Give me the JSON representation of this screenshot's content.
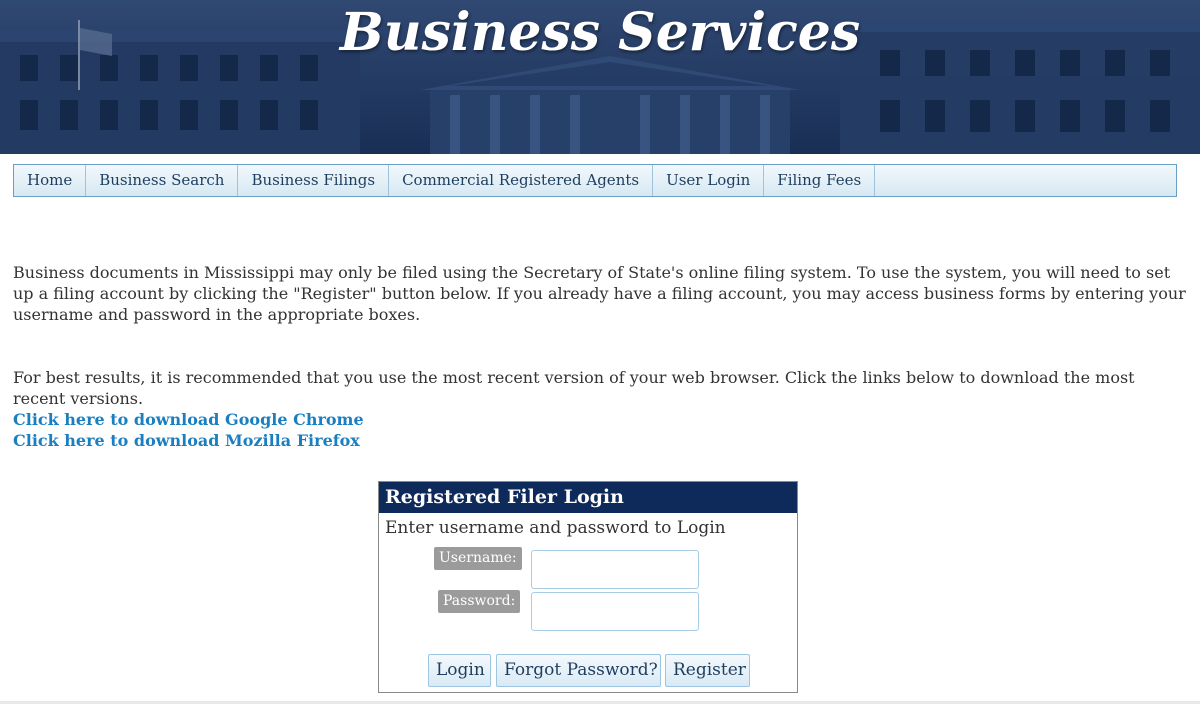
{
  "banner": {
    "title": "Business Services"
  },
  "nav": {
    "items": [
      {
        "label": "Home"
      },
      {
        "label": "Business Search"
      },
      {
        "label": "Business Filings"
      },
      {
        "label": "Commercial Registered Agents"
      },
      {
        "label": "User Login"
      },
      {
        "label": "Filing Fees"
      }
    ]
  },
  "content": {
    "intro": "Business documents in Mississippi may only be filed using the Secretary of State's online filing system. To use the system, you will need to set up a filing account by clicking the \"Register\" button below. If you already have a filing account, you may access business forms by entering your username and password in the appropriate boxes.",
    "browser_note": "For best results, it is recommended that you use the most recent version of your web browser. Click the links below to download the most recent versions.",
    "chrome_link": "Click here to download Google Chrome",
    "firefox_link": "Click here to download Mozilla Firefox"
  },
  "login": {
    "header": "Registered Filer Login",
    "instructions": "Enter username and password to Login",
    "username_label": "Username:",
    "password_label": "Password:",
    "username_value": "",
    "password_value": "",
    "login_button": "Login",
    "forgot_button": "Forgot Password?",
    "register_button": "Register"
  },
  "colors": {
    "banner_bg": "#1f3660",
    "nav_text": "#1e3e5f",
    "nav_border": "#6a9fc4",
    "link": "#1a7fc1",
    "login_header_bg": "#0d2a5b",
    "label_bg": "#9b9b9b"
  }
}
